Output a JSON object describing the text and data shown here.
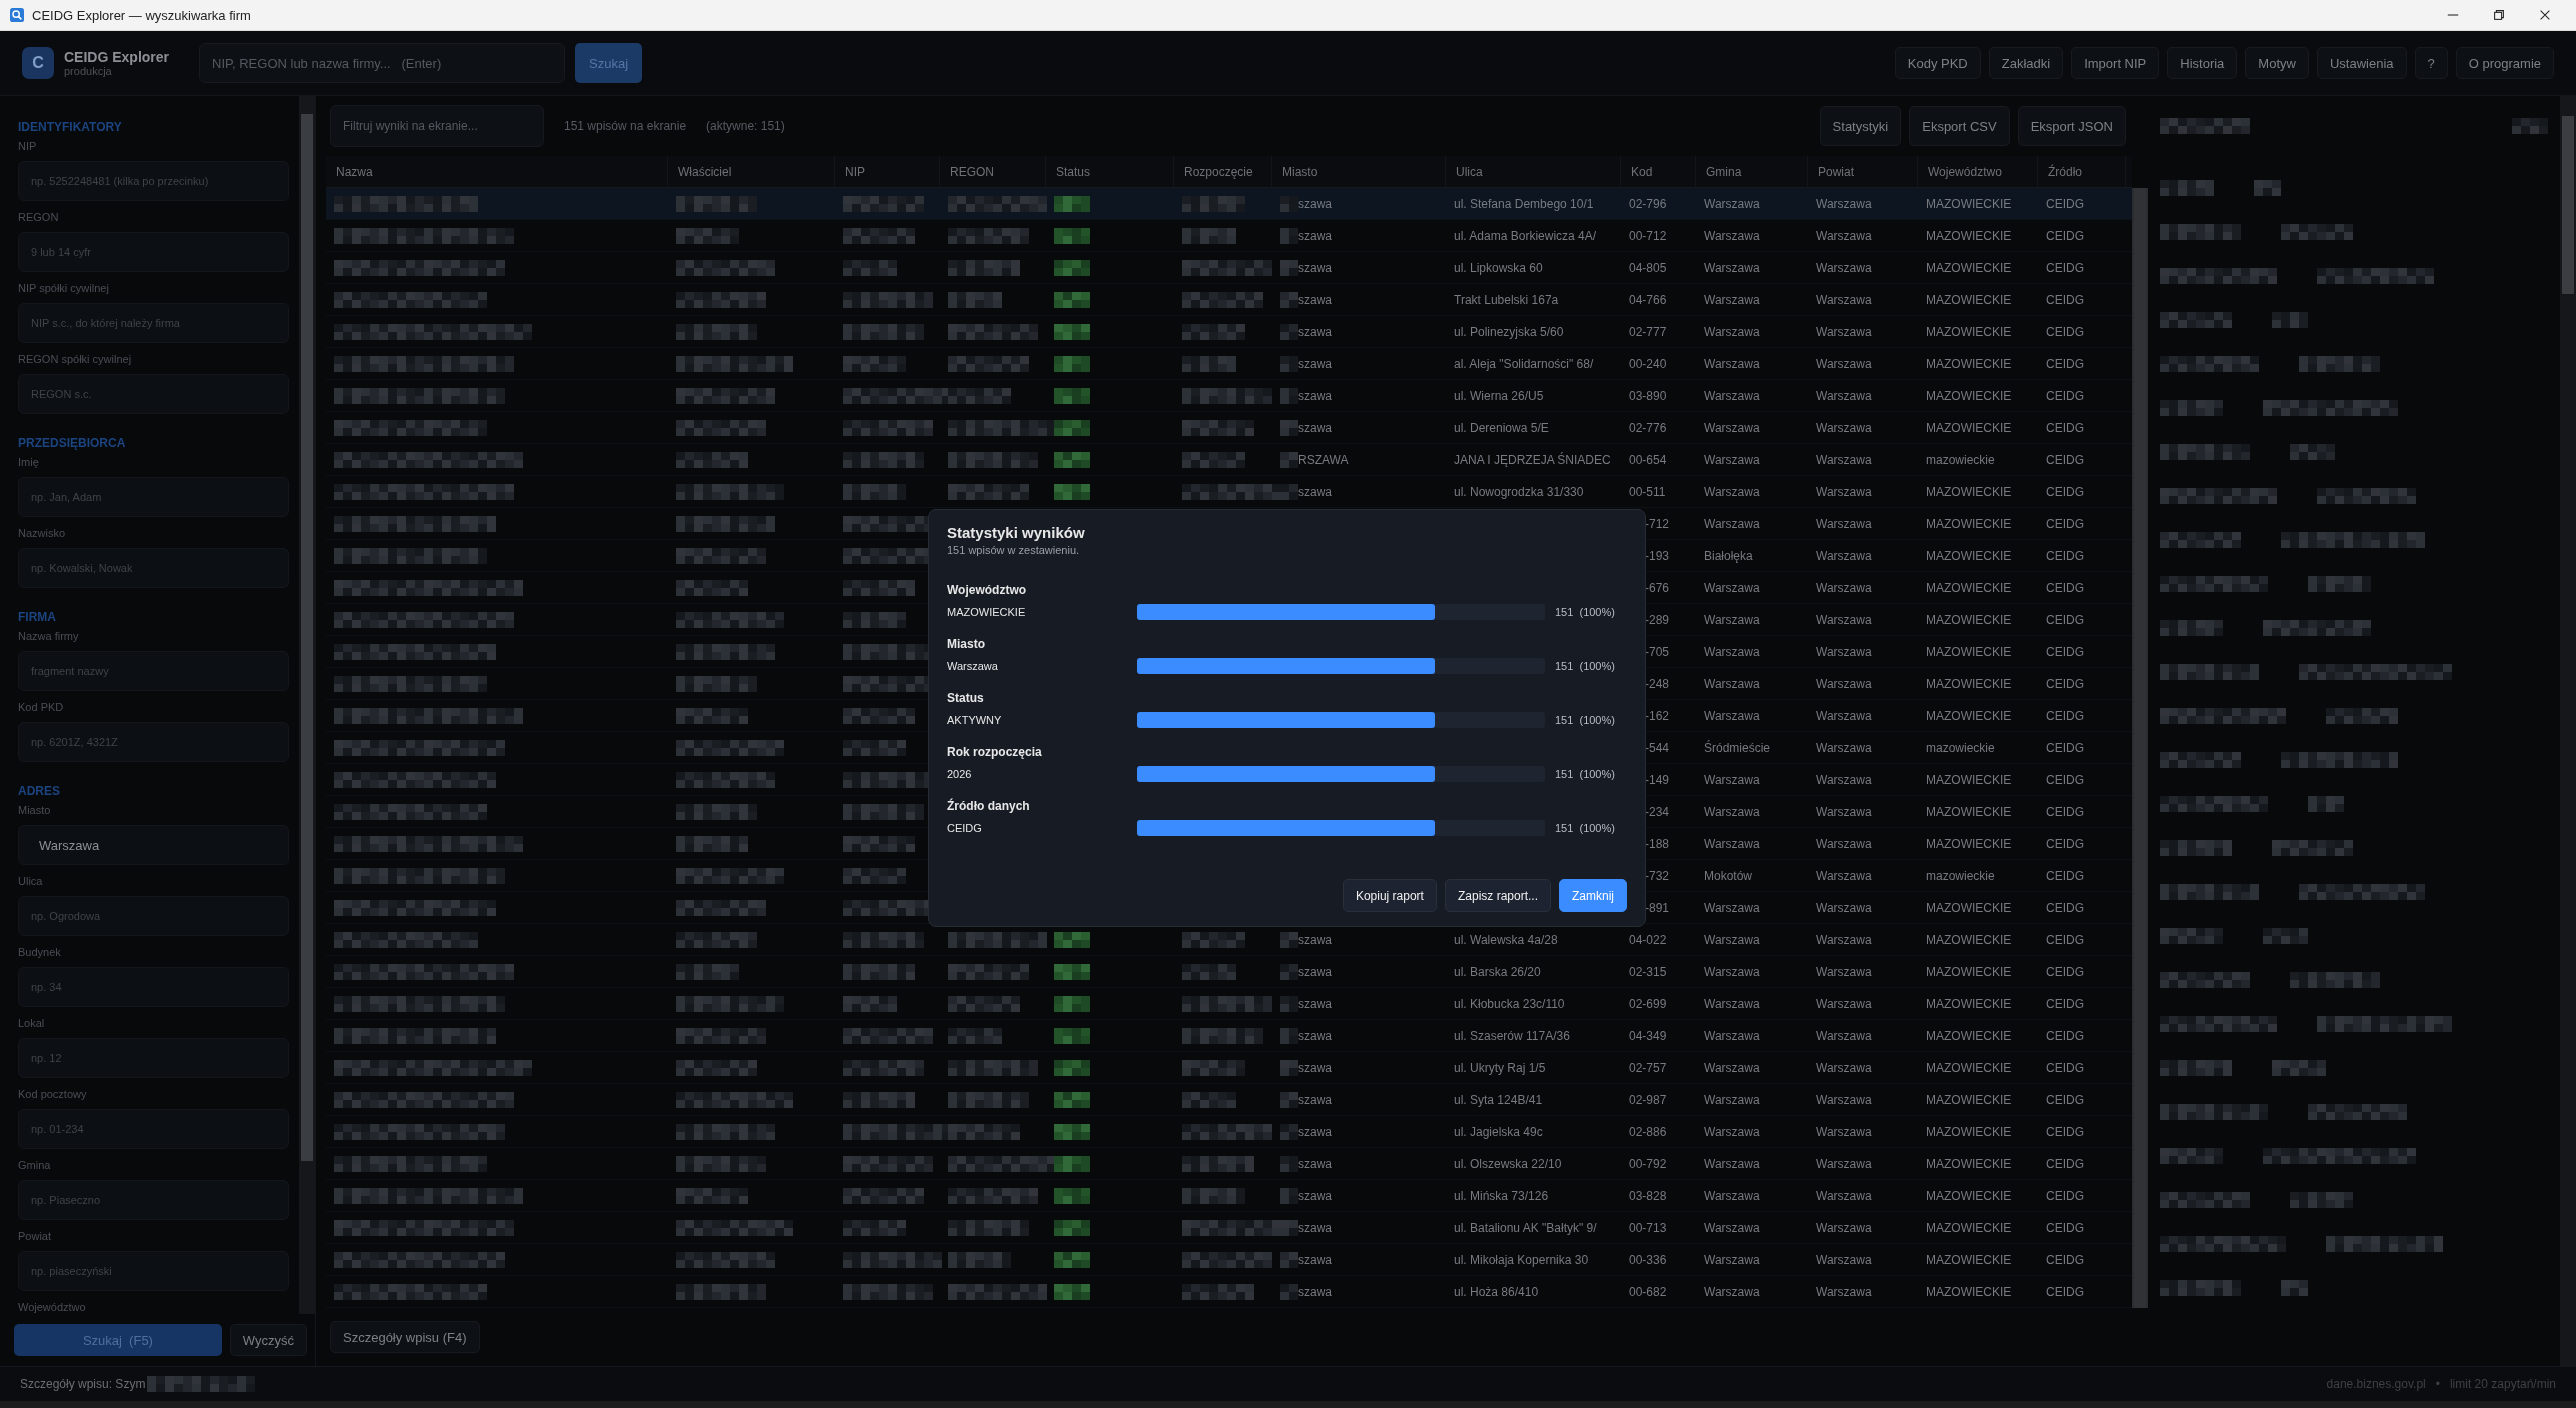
{
  "window": {
    "title": "CEIDG Explorer — wyszukiwarka firm"
  },
  "header": {
    "logo_letter": "C",
    "app_name": "CEIDG Explorer",
    "environment": "produkcja",
    "search": {
      "placeholder": "NIP, REGON lub nazwa firmy...   (Enter)"
    },
    "search_button": "Szukaj",
    "nav": [
      "Kody PKD",
      "Zakładki",
      "Import NIP",
      "Historia",
      "Motyw",
      "Ustawienia",
      "?",
      "O programie"
    ]
  },
  "sidebar": {
    "sections": [
      {
        "title": "IDENTYFIKATORY",
        "fields": [
          {
            "label": "NIP",
            "placeholder": "np. 5252248481 (kilka po przecinku)"
          },
          {
            "label": "REGON",
            "placeholder": "9 lub 14 cyfr"
          },
          {
            "label": "NIP spółki cywilnej",
            "placeholder": "NIP s.c., do której należy firma"
          },
          {
            "label": "REGON spółki cywilnej",
            "placeholder": "REGON s.c."
          }
        ]
      },
      {
        "title": "PRZEDSIĘBIORCA",
        "fields": [
          {
            "label": "Imię",
            "placeholder": "np. Jan, Adam"
          },
          {
            "label": "Nazwisko",
            "placeholder": "np. Kowalski, Nowak"
          }
        ]
      },
      {
        "title": "FIRMA",
        "fields": [
          {
            "label": "Nazwa firmy",
            "placeholder": "fragment nazwy"
          },
          {
            "label": "Kod PKD",
            "placeholder": "np. 6201Z, 4321Z"
          }
        ]
      },
      {
        "title": "ADRES",
        "fields": [
          {
            "label": "Miasto",
            "value": "Warszawa"
          },
          {
            "label": "Ulica",
            "placeholder": "np. Ogrodowa"
          },
          {
            "label": "Budynek",
            "placeholder": "np. 34"
          },
          {
            "label": "Lokal",
            "placeholder": "np. 12"
          },
          {
            "label": "Kod pocztowy",
            "placeholder": "np. 01-234"
          },
          {
            "label": "Gmina",
            "placeholder": "np. Piaseczno"
          },
          {
            "label": "Powiat",
            "placeholder": "np. piaseczyński"
          },
          {
            "label": "Województwo"
          }
        ]
      }
    ],
    "search_button": "Szukaj  (F5)",
    "clear_button": "Wyczyść"
  },
  "results": {
    "filter": {
      "placeholder": "Filtruj wyniki na ekranie..."
    },
    "count": "151 wpisów na ekranie",
    "active": "(aktywne: 151)",
    "buttons": [
      "Statystyki",
      "Eksport CSV",
      "Eksport JSON"
    ],
    "columns": [
      {
        "label": "Nazwa",
        "kind": "redacted"
      },
      {
        "label": "Właściciel",
        "kind": "redacted"
      },
      {
        "label": "NIP",
        "kind": "redacted"
      },
      {
        "label": "REGON",
        "kind": "redacted"
      },
      {
        "label": "Status",
        "kind": "badge"
      },
      {
        "label": "Rozpoczęcie",
        "kind": "redacted"
      },
      {
        "label": "Miasto",
        "kind": "miasto"
      },
      {
        "label": "Ulica",
        "kind": "ulica"
      },
      {
        "label": "Kod",
        "kind": "kod"
      },
      {
        "label": "Gmina",
        "kind": "gmina"
      },
      {
        "label": "Powiat",
        "kind": "powiat"
      },
      {
        "label": "Województwo",
        "kind": "wojewodztwo"
      },
      {
        "label": "Źródło",
        "kind": "zrodlo"
      }
    ],
    "rows": [
      {
        "selected": true,
        "miasto": "szawa",
        "ulica": "ul. Stefana Dembego 10/1",
        "kod": "02-796",
        "gmina": "Warszawa",
        "powiat": "Warszawa",
        "wojewodztwo": "MAZOWIECKIE",
        "zrodlo": "CEIDG"
      },
      {
        "selected": false,
        "miasto": "szawa",
        "ulica": "ul. Adama Borkiewicza 4A/",
        "kod": "00-712",
        "gmina": "Warszawa",
        "powiat": "Warszawa",
        "wojewodztwo": "MAZOWIECKIE",
        "zrodlo": "CEIDG"
      },
      {
        "selected": false,
        "miasto": "szawa",
        "ulica": "ul. Lipkowska 60",
        "kod": "04-805",
        "gmina": "Warszawa",
        "powiat": "Warszawa",
        "wojewodztwo": "MAZOWIECKIE",
        "zrodlo": "CEIDG"
      },
      {
        "selected": false,
        "miasto": "szawa",
        "ulica": "Trakt Lubelski 167a",
        "kod": "04-766",
        "gmina": "Warszawa",
        "powiat": "Warszawa",
        "wojewodztwo": "MAZOWIECKIE",
        "zrodlo": "CEIDG"
      },
      {
        "selected": false,
        "miasto": "szawa",
        "ulica": "ul. Polinezyjska 5/60",
        "kod": "02-777",
        "gmina": "Warszawa",
        "powiat": "Warszawa",
        "wojewodztwo": "MAZOWIECKIE",
        "zrodlo": "CEIDG"
      },
      {
        "selected": false,
        "miasto": "szawa",
        "ulica": "al. Aleja \"Solidarności\" 68/",
        "kod": "00-240",
        "gmina": "Warszawa",
        "powiat": "Warszawa",
        "wojewodztwo": "MAZOWIECKIE",
        "zrodlo": "CEIDG"
      },
      {
        "selected": false,
        "miasto": "szawa",
        "ulica": "ul. Wierna 26/U5",
        "kod": "03-890",
        "gmina": "Warszawa",
        "powiat": "Warszawa",
        "wojewodztwo": "MAZOWIECKIE",
        "zrodlo": "CEIDG"
      },
      {
        "selected": false,
        "miasto": "szawa",
        "ulica": "ul. Dereniowa 5/E",
        "kod": "02-776",
        "gmina": "Warszawa",
        "powiat": "Warszawa",
        "wojewodztwo": "MAZOWIECKIE",
        "zrodlo": "CEIDG"
      },
      {
        "selected": false,
        "miasto": "RSZAWA",
        "ulica": "JANA I JĘDRZEJA ŚNIADEC",
        "kod": "00-654",
        "gmina": "Warszawa",
        "powiat": "Warszawa",
        "wojewodztwo": "mazowieckie",
        "zrodlo": "CEIDG"
      },
      {
        "selected": false,
        "miasto": "szawa",
        "ulica": "ul. Nowogrodzka 31/330",
        "kod": "00-511",
        "gmina": "Warszawa",
        "powiat": "Warszawa",
        "wojewodztwo": "MAZOWIECKIE",
        "zrodlo": "CEIDG"
      },
      {
        "selected": false,
        "kod": "-712",
        "gmina": "Warszawa",
        "powiat": "Warszawa",
        "wojewodztwo": "MAZOWIECKIE",
        "zrodlo": "CEIDG"
      },
      {
        "selected": false,
        "kod": "-193",
        "gmina": "Białołęka",
        "powiat": "Warszawa",
        "wojewodztwo": "MAZOWIECKIE",
        "zrodlo": "CEIDG"
      },
      {
        "selected": false,
        "kod": "-676",
        "gmina": "Warszawa",
        "powiat": "Warszawa",
        "wojewodztwo": "MAZOWIECKIE",
        "zrodlo": "CEIDG"
      },
      {
        "selected": false,
        "kod": "-289",
        "gmina": "Warszawa",
        "powiat": "Warszawa",
        "wojewodztwo": "MAZOWIECKIE",
        "zrodlo": "CEIDG"
      },
      {
        "selected": false,
        "kod": "-705",
        "gmina": "Warszawa",
        "powiat": "Warszawa",
        "wojewodztwo": "MAZOWIECKIE",
        "zrodlo": "CEIDG"
      },
      {
        "selected": false,
        "kod": "-248",
        "gmina": "Warszawa",
        "powiat": "Warszawa",
        "wojewodztwo": "MAZOWIECKIE",
        "zrodlo": "CEIDG"
      },
      {
        "selected": false,
        "kod": "-162",
        "gmina": "Warszawa",
        "powiat": "Warszawa",
        "wojewodztwo": "MAZOWIECKIE",
        "zrodlo": "CEIDG"
      },
      {
        "selected": false,
        "kod": "-544",
        "gmina": "Śródmieście",
        "powiat": "Warszawa",
        "wojewodztwo": "mazowieckie",
        "zrodlo": "CEIDG"
      },
      {
        "selected": false,
        "kod": "-149",
        "gmina": "Warszawa",
        "powiat": "Warszawa",
        "wojewodztwo": "MAZOWIECKIE",
        "zrodlo": "CEIDG"
      },
      {
        "selected": false,
        "kod": "-234",
        "gmina": "Warszawa",
        "powiat": "Warszawa",
        "wojewodztwo": "MAZOWIECKIE",
        "zrodlo": "CEIDG"
      },
      {
        "selected": false,
        "kod": "-188",
        "gmina": "Warszawa",
        "powiat": "Warszawa",
        "wojewodztwo": "MAZOWIECKIE",
        "zrodlo": "CEIDG"
      },
      {
        "selected": false,
        "kod": "-732",
        "gmina": "Mokotów",
        "powiat": "Warszawa",
        "wojewodztwo": "mazowieckie",
        "zrodlo": "CEIDG"
      },
      {
        "selected": false,
        "kod": "-891",
        "gmina": "Warszawa",
        "powiat": "Warszawa",
        "wojewodztwo": "MAZOWIECKIE",
        "zrodlo": "CEIDG"
      },
      {
        "selected": false,
        "miasto": "szawa",
        "ulica": "ul. Walewska 4a/28",
        "kod": "04-022",
        "gmina": "Warszawa",
        "powiat": "Warszawa",
        "wojewodztwo": "MAZOWIECKIE",
        "zrodlo": "CEIDG"
      },
      {
        "selected": false,
        "miasto": "szawa",
        "ulica": "ul. Barska 26/20",
        "kod": "02-315",
        "gmina": "Warszawa",
        "powiat": "Warszawa",
        "wojewodztwo": "MAZOWIECKIE",
        "zrodlo": "CEIDG"
      },
      {
        "selected": false,
        "miasto": "szawa",
        "ulica": "ul. Kłobucka 23c/110",
        "kod": "02-699",
        "gmina": "Warszawa",
        "powiat": "Warszawa",
        "wojewodztwo": "MAZOWIECKIE",
        "zrodlo": "CEIDG"
      },
      {
        "selected": false,
        "miasto": "szawa",
        "ulica": "ul. Szaserów 117A/36",
        "kod": "04-349",
        "gmina": "Warszawa",
        "powiat": "Warszawa",
        "wojewodztwo": "MAZOWIECKIE",
        "zrodlo": "CEIDG"
      },
      {
        "selected": false,
        "miasto": "szawa",
        "ulica": "ul. Ukryty Raj 1/5",
        "kod": "02-757",
        "gmina": "Warszawa",
        "powiat": "Warszawa",
        "wojewodztwo": "MAZOWIECKIE",
        "zrodlo": "CEIDG"
      },
      {
        "selected": false,
        "miasto": "szawa",
        "ulica": "ul. Syta 124B/41",
        "kod": "02-987",
        "gmina": "Warszawa",
        "powiat": "Warszawa",
        "wojewodztwo": "MAZOWIECKIE",
        "zrodlo": "CEIDG"
      },
      {
        "selected": false,
        "miasto": "szawa",
        "ulica": "ul. Jagielska 49c",
        "kod": "02-886",
        "gmina": "Warszawa",
        "powiat": "Warszawa",
        "wojewodztwo": "MAZOWIECKIE",
        "zrodlo": "CEIDG"
      },
      {
        "selected": false,
        "miasto": "szawa",
        "ulica": "ul. Olszewska 22/10",
        "kod": "00-792",
        "gmina": "Warszawa",
        "powiat": "Warszawa",
        "wojewodztwo": "MAZOWIECKIE",
        "zrodlo": "CEIDG"
      },
      {
        "selected": false,
        "miasto": "szawa",
        "ulica": "ul. Mińska 73/126",
        "kod": "03-828",
        "gmina": "Warszawa",
        "powiat": "Warszawa",
        "wojewodztwo": "MAZOWIECKIE",
        "zrodlo": "CEIDG"
      },
      {
        "selected": false,
        "miasto": "szawa",
        "ulica": "ul. Batalionu AK \"Bałtyk\" 9/",
        "kod": "00-713",
        "gmina": "Warszawa",
        "powiat": "Warszawa",
        "wojewodztwo": "MAZOWIECKIE",
        "zrodlo": "CEIDG"
      },
      {
        "selected": false,
        "miasto": "szawa",
        "ulica": "ul. Mikołaja Kopernika 30",
        "kod": "00-336",
        "gmina": "Warszawa",
        "powiat": "Warszawa",
        "wojewodztwo": "MAZOWIECKIE",
        "zrodlo": "CEIDG"
      },
      {
        "selected": false,
        "miasto": "szawa",
        "ulica": "ul. Hoża 86/410",
        "kod": "00-682",
        "gmina": "Warszawa",
        "powiat": "Warszawa",
        "wojewodztwo": "MAZOWIECKIE",
        "zrodlo": "CEIDG"
      }
    ],
    "details_button": "Szczegóły wpisu  (F4)"
  },
  "stats_dialog": {
    "title": "Statystyki wyników",
    "subtitle": "151 wpisów w zestawieniu.",
    "groups": [
      {
        "label": "Województwo",
        "value": "MAZOWIECKIE",
        "level": 0.73,
        "reading": "151  (100%)"
      },
      {
        "label": "Miasto",
        "value": "Warszawa",
        "level": 0.73,
        "reading": "151  (100%)"
      },
      {
        "label": "Status",
        "value": "AKTYWNY",
        "level": 0.73,
        "reading": "151  (100%)"
      },
      {
        "label": "Rok rozpoczęcia",
        "value": "2026",
        "level": 0.73,
        "reading": "151  (100%)"
      },
      {
        "label": "Źródło danych",
        "value": "CEIDG",
        "level": 0.73,
        "reading": "151  (100%)"
      }
    ],
    "buttons": [
      {
        "label": "Kopiuj raport",
        "primary": false
      },
      {
        "label": "Zapisz raport...",
        "primary": false
      },
      {
        "label": "Zamknij",
        "primary": true
      }
    ]
  },
  "status_bar": {
    "details": "Szczegóły wpisu: Szym",
    "source": "dane.biznes.gov.pl",
    "separator": "•",
    "limit": "limit 20 zapytań/min"
  }
}
